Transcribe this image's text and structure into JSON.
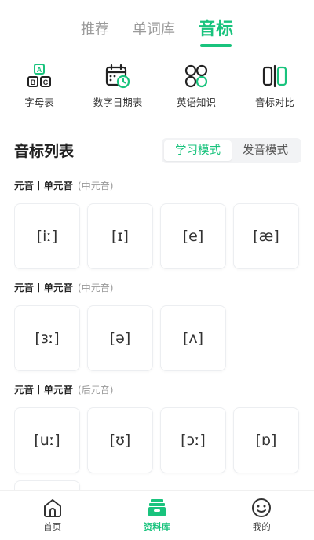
{
  "top_tabs": [
    {
      "label": "推荐",
      "active": false
    },
    {
      "label": "单词库",
      "active": false
    },
    {
      "label": "音标",
      "active": true
    }
  ],
  "quick_links": [
    {
      "label": "字母表",
      "icon": "alphabet-blocks-icon"
    },
    {
      "label": "数字日期表",
      "icon": "calendar-clock-icon"
    },
    {
      "label": "英语知识",
      "icon": "knowledge-grid-icon"
    },
    {
      "label": "音标对比",
      "icon": "compare-icon"
    }
  ],
  "list_header": {
    "title": "音标列表",
    "modes": [
      "学习模式",
      "发音模式"
    ],
    "active_mode": "学习模式"
  },
  "groups": [
    {
      "title": "元音丨单元音",
      "sub": "(中元音)",
      "symbols": [
        "[iː]",
        "[ɪ]",
        "[e]",
        "[æ]"
      ]
    },
    {
      "title": "元音丨单元音",
      "sub": "(中元音)",
      "symbols": [
        "[ɜː]",
        "[ə]",
        "[ʌ]"
      ]
    },
    {
      "title": "元音丨单元音",
      "sub": "(后元音)",
      "symbols": [
        "[uː]",
        "[ʊ]",
        "[ɔː]",
        "[ɒ]"
      ]
    }
  ],
  "bottom_nav": [
    {
      "label": "首页",
      "icon": "home-icon",
      "active": false
    },
    {
      "label": "资料库",
      "icon": "library-icon",
      "active": true
    },
    {
      "label": "我的",
      "icon": "smiley-icon",
      "active": false
    }
  ],
  "colors": {
    "accent": "#19c37d",
    "muted": "#9a9a9a"
  }
}
